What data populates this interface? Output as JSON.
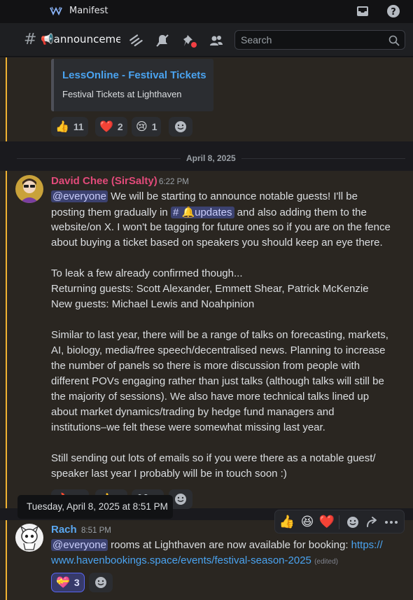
{
  "app": {
    "title": "Manifest"
  },
  "channel": {
    "name": "📢announcements"
  },
  "search": {
    "placeholder": "Search"
  },
  "embed": {
    "title": "LessOnline - Festival Tickets",
    "description": "Festival Tickets at Lighthaven"
  },
  "reactions_top": [
    {
      "emoji": "👍",
      "count": "11"
    },
    {
      "emoji": "❤️",
      "count": "2"
    },
    {
      "emoji": "😢",
      "count": "1"
    }
  ],
  "date_divider": "April 8, 2025",
  "message1": {
    "author": "David Chee (SirSalty)",
    "time": "6:22 PM",
    "author_color": "#e24a7a",
    "mention": "@everyone",
    "l1": " We will be starting to announce notable guests! I'll be",
    "l2a": "posting them gradually in ",
    "channel_mention": "# 🔔updates",
    "l2b": " and also adding them to the",
    "l3": "website/on X. I won't be tagging for future ones so if you are on the fence",
    "l4": "about buying a ticket based on speakers you should keep an eye there.",
    "l5": "To leak a few already confirmed though...",
    "l6": "Returning guests: Scott Alexander, Emmett Shear, Patrick McKenzie",
    "l7": "New guests: Michael Lewis and Noahpinion",
    "l8": "Similar to last year, there will be a range of talks on forecasting, markets,",
    "l9": "AI, biology, media/free speech/decentralised news. Planning to increase",
    "l10": "the number of panels so there is more discussion from people with",
    "l11": "different POVs engaging rather than just talks (although talks will still be",
    "l12": "the majority of sessions). We also have more technical talks lined up",
    "l13": "about market dynamics/trading by hedge fund managers and",
    "l14": "institutions–we felt these were somewhat missing last year.",
    "l15": "Still sending out lots of emails so if you were there as a notable guest/",
    "l16": "speaker last year I probably will be in touch soon :)"
  },
  "reactions_mid": [
    {
      "emoji": "🔥",
      "count": "27"
    },
    {
      "emoji": "👍",
      "count": "2"
    },
    {
      "emoji": "👀",
      "count": "3"
    }
  ],
  "tooltip": "Tuesday, April 8, 2025 at 8:51 PM",
  "message2": {
    "author": "Rach",
    "time": "8:51 PM",
    "author_color": "#5aa7f0",
    "mention": "@everyone",
    "l1": " rooms at Lighthaven are now available for booking: ",
    "link1": "https://",
    "link2": "www.havenbookings.space/events/festival-season-2025",
    "edited": "(edited)"
  },
  "reactions_bottom": [
    {
      "emoji": "💝",
      "count": "3"
    }
  ],
  "hover_toolbar": {
    "e1": "👍",
    "e2": "😆",
    "e3": "❤️"
  },
  "colors": {
    "accent": "#5865f2",
    "highlight_bar": "#f0b232",
    "link": "#4aa3f0"
  }
}
